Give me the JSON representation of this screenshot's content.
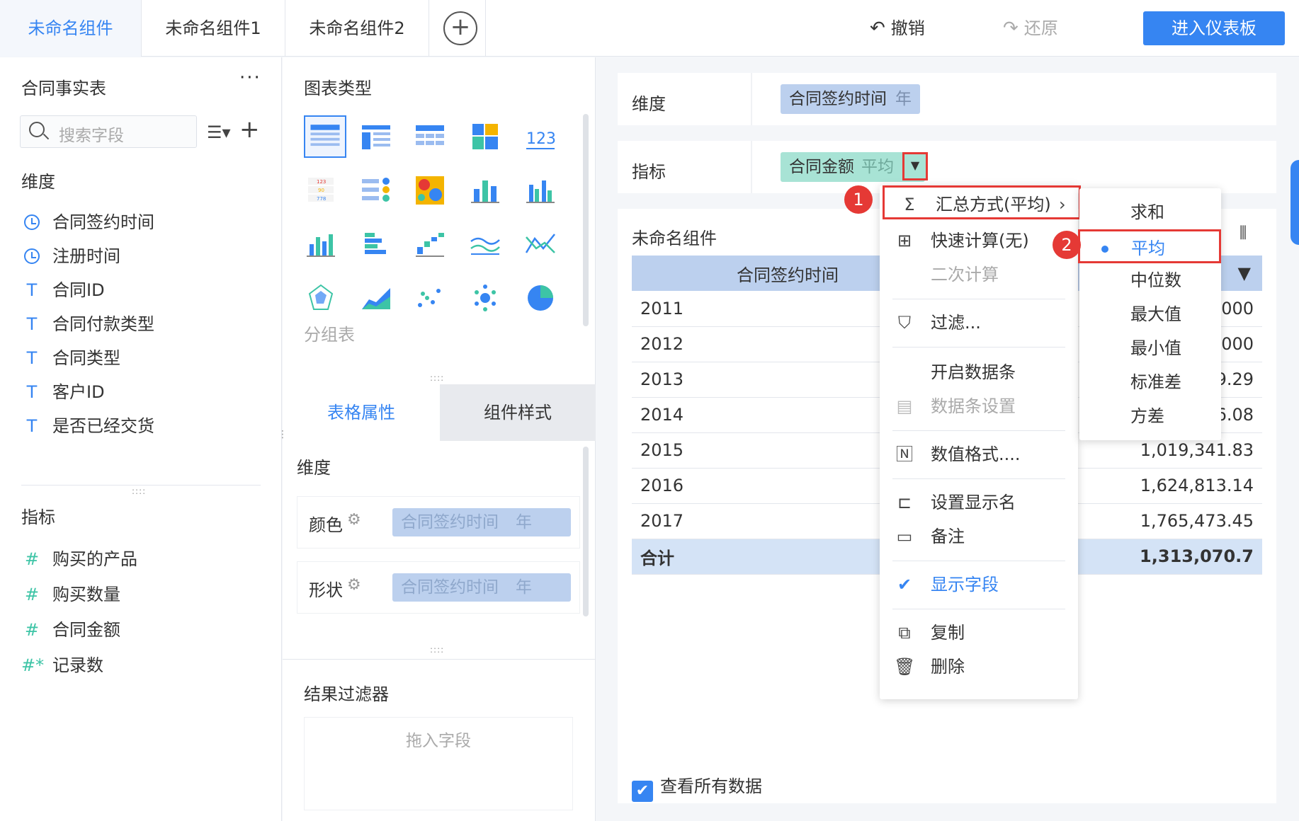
{
  "tabs": [
    {
      "label": "未命名组件"
    },
    {
      "label": "未命名组件1"
    },
    {
      "label": "未命名组件2"
    }
  ],
  "toolbar": {
    "undo": "撤销",
    "redo": "还原",
    "enter": "进入仪表板"
  },
  "left": {
    "table_name": "合同事实表",
    "more": "···",
    "search_placeholder": "搜索字段",
    "dimension_label": "维度",
    "dimensions": [
      {
        "icon": "clock-icon",
        "label": "合同签约时间"
      },
      {
        "icon": "clock-icon",
        "label": "注册时间"
      },
      {
        "icon": "T",
        "label": "合同ID"
      },
      {
        "icon": "T",
        "label": "合同付款类型"
      },
      {
        "icon": "T",
        "label": "合同类型"
      },
      {
        "icon": "T",
        "label": "客户ID"
      },
      {
        "icon": "T",
        "label": "是否已经交货"
      }
    ],
    "metric_label": "指标",
    "metrics": [
      {
        "icon": "#",
        "label": "购买的产品"
      },
      {
        "icon": "#",
        "label": "购买数量"
      },
      {
        "icon": "#",
        "label": "合同金额"
      },
      {
        "icon": "#*",
        "label": "记录数"
      }
    ]
  },
  "mid": {
    "chart_type_title": "图表类型",
    "grouped_table": "分组表",
    "tabs": {
      "table_props": "表格属性",
      "widget_style": "组件样式"
    },
    "dimension_label": "维度",
    "color_label": "颜色",
    "shape_label": "形状",
    "field_name": "合同签约时间",
    "field_sub": "年",
    "result_filter": "结果过滤器",
    "drop_hint": "拖入字段"
  },
  "editor": {
    "dimension_label": "维度",
    "dimension_field": "合同签约时间",
    "dimension_sub": "年",
    "metric_label": "指标",
    "metric_field": "合同金额",
    "metric_sub": "平均"
  },
  "widget": {
    "title": "未命名组件",
    "header": "合同签约时间",
    "rows": [
      {
        "year": "2011",
        "value": ",000"
      },
      {
        "year": "2012",
        "value": ",000"
      },
      {
        "year": "2013",
        "value": "9.29"
      },
      {
        "year": "2014",
        "value": "6.08"
      },
      {
        "year": "2015",
        "value": "1,019,341.83"
      },
      {
        "year": "2016",
        "value": "1,624,813.14"
      },
      {
        "year": "2017",
        "value": "1,765,473.45"
      }
    ],
    "total_label": "合计",
    "total_value": "1,313,070.7",
    "view_all": "查看所有数据"
  },
  "menu": {
    "summary": "汇总方式(平均)",
    "quick_calc": "快速计算(无)",
    "second_calc": "二次计算",
    "filter": "过滤...",
    "enable_databar": "开启数据条",
    "databar_settings": "数据条设置",
    "number_format": "数值格式....",
    "set_display_name": "设置显示名",
    "note": "备注",
    "show_field": "显示字段",
    "copy": "复制",
    "delete": "删除"
  },
  "submenu": [
    "求和",
    "平均",
    "中位数",
    "最大值",
    "最小值",
    "标准差",
    "方差"
  ],
  "badges": [
    "1",
    "2"
  ],
  "colors": {
    "accent": "#3685f2",
    "highlight": "#e53935",
    "dim_pill": "#bcd0ee",
    "metric_pill": "#a8e3d5"
  }
}
